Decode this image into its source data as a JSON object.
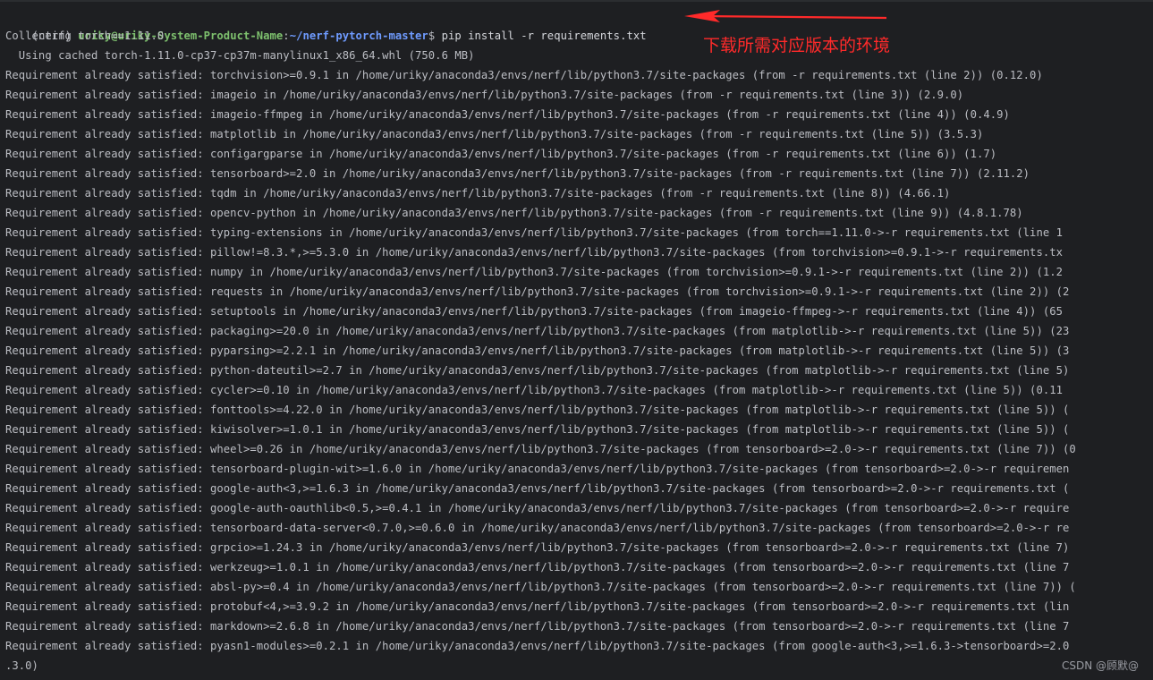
{
  "prompt": {
    "env": "(nerf) ",
    "user_host": "uriky@uriky-System-Product-Name",
    "colon": ":",
    "path": "~/nerf-pytorch-master",
    "symbol": "$ ",
    "command": "pip install -r requirements.txt"
  },
  "output_lines": [
    "Collecting torch==1.11.0",
    "  Using cached torch-1.11.0-cp37-cp37m-manylinux1_x86_64.whl (750.6 MB)",
    "Requirement already satisfied: torchvision>=0.9.1 in /home/uriky/anaconda3/envs/nerf/lib/python3.7/site-packages (from -r requirements.txt (line 2)) (0.12.0)",
    "Requirement already satisfied: imageio in /home/uriky/anaconda3/envs/nerf/lib/python3.7/site-packages (from -r requirements.txt (line 3)) (2.9.0)",
    "Requirement already satisfied: imageio-ffmpeg in /home/uriky/anaconda3/envs/nerf/lib/python3.7/site-packages (from -r requirements.txt (line 4)) (0.4.9)",
    "Requirement already satisfied: matplotlib in /home/uriky/anaconda3/envs/nerf/lib/python3.7/site-packages (from -r requirements.txt (line 5)) (3.5.3)",
    "Requirement already satisfied: configargparse in /home/uriky/anaconda3/envs/nerf/lib/python3.7/site-packages (from -r requirements.txt (line 6)) (1.7)",
    "Requirement already satisfied: tensorboard>=2.0 in /home/uriky/anaconda3/envs/nerf/lib/python3.7/site-packages (from -r requirements.txt (line 7)) (2.11.2)",
    "Requirement already satisfied: tqdm in /home/uriky/anaconda3/envs/nerf/lib/python3.7/site-packages (from -r requirements.txt (line 8)) (4.66.1)",
    "Requirement already satisfied: opencv-python in /home/uriky/anaconda3/envs/nerf/lib/python3.7/site-packages (from -r requirements.txt (line 9)) (4.8.1.78)",
    "Requirement already satisfied: typing-extensions in /home/uriky/anaconda3/envs/nerf/lib/python3.7/site-packages (from torch==1.11.0->-r requirements.txt (line 1",
    "Requirement already satisfied: pillow!=8.3.*,>=5.3.0 in /home/uriky/anaconda3/envs/nerf/lib/python3.7/site-packages (from torchvision>=0.9.1->-r requirements.tx",
    "Requirement already satisfied: numpy in /home/uriky/anaconda3/envs/nerf/lib/python3.7/site-packages (from torchvision>=0.9.1->-r requirements.txt (line 2)) (1.2",
    "Requirement already satisfied: requests in /home/uriky/anaconda3/envs/nerf/lib/python3.7/site-packages (from torchvision>=0.9.1->-r requirements.txt (line 2)) (2",
    "Requirement already satisfied: setuptools in /home/uriky/anaconda3/envs/nerf/lib/python3.7/site-packages (from imageio-ffmpeg->-r requirements.txt (line 4)) (65",
    "Requirement already satisfied: packaging>=20.0 in /home/uriky/anaconda3/envs/nerf/lib/python3.7/site-packages (from matplotlib->-r requirements.txt (line 5)) (23",
    "Requirement already satisfied: pyparsing>=2.2.1 in /home/uriky/anaconda3/envs/nerf/lib/python3.7/site-packages (from matplotlib->-r requirements.txt (line 5)) (3",
    "Requirement already satisfied: python-dateutil>=2.7 in /home/uriky/anaconda3/envs/nerf/lib/python3.7/site-packages (from matplotlib->-r requirements.txt (line 5)",
    "Requirement already satisfied: cycler>=0.10 in /home/uriky/anaconda3/envs/nerf/lib/python3.7/site-packages (from matplotlib->-r requirements.txt (line 5)) (0.11",
    "Requirement already satisfied: fonttools>=4.22.0 in /home/uriky/anaconda3/envs/nerf/lib/python3.7/site-packages (from matplotlib->-r requirements.txt (line 5)) (",
    "Requirement already satisfied: kiwisolver>=1.0.1 in /home/uriky/anaconda3/envs/nerf/lib/python3.7/site-packages (from matplotlib->-r requirements.txt (line 5)) (",
    "Requirement already satisfied: wheel>=0.26 in /home/uriky/anaconda3/envs/nerf/lib/python3.7/site-packages (from tensorboard>=2.0->-r requirements.txt (line 7)) (0",
    "Requirement already satisfied: tensorboard-plugin-wit>=1.6.0 in /home/uriky/anaconda3/envs/nerf/lib/python3.7/site-packages (from tensorboard>=2.0->-r requiremen",
    "Requirement already satisfied: google-auth<3,>=1.6.3 in /home/uriky/anaconda3/envs/nerf/lib/python3.7/site-packages (from tensorboard>=2.0->-r requirements.txt (",
    "Requirement already satisfied: google-auth-oauthlib<0.5,>=0.4.1 in /home/uriky/anaconda3/envs/nerf/lib/python3.7/site-packages (from tensorboard>=2.0->-r require",
    "Requirement already satisfied: tensorboard-data-server<0.7.0,>=0.6.0 in /home/uriky/anaconda3/envs/nerf/lib/python3.7/site-packages (from tensorboard>=2.0->-r re",
    "Requirement already satisfied: grpcio>=1.24.3 in /home/uriky/anaconda3/envs/nerf/lib/python3.7/site-packages (from tensorboard>=2.0->-r requirements.txt (line 7)",
    "Requirement already satisfied: werkzeug>=1.0.1 in /home/uriky/anaconda3/envs/nerf/lib/python3.7/site-packages (from tensorboard>=2.0->-r requirements.txt (line 7",
    "Requirement already satisfied: absl-py>=0.4 in /home/uriky/anaconda3/envs/nerf/lib/python3.7/site-packages (from tensorboard>=2.0->-r requirements.txt (line 7)) (",
    "Requirement already satisfied: protobuf<4,>=3.9.2 in /home/uriky/anaconda3/envs/nerf/lib/python3.7/site-packages (from tensorboard>=2.0->-r requirements.txt (lin",
    "Requirement already satisfied: markdown>=2.6.8 in /home/uriky/anaconda3/envs/nerf/lib/python3.7/site-packages (from tensorboard>=2.0->-r requirements.txt (line 7",
    "Requirement already satisfied: pyasn1-modules>=0.2.1 in /home/uriky/anaconda3/envs/nerf/lib/python3.7/site-packages (from google-auth<3,>=1.6.3->tensorboard>=2.0",
    ".3.0)"
  ],
  "annotation": {
    "text": "下载所需对应版本的环境",
    "color": "#ff2a2a"
  },
  "watermark": "CSDN @顾默@",
  "colors": {
    "background": "#1e1f22",
    "text": "#bcbec4",
    "user_host": "#7ec16e",
    "path": "#6f9bff",
    "annotation": "#ff2a2a"
  }
}
